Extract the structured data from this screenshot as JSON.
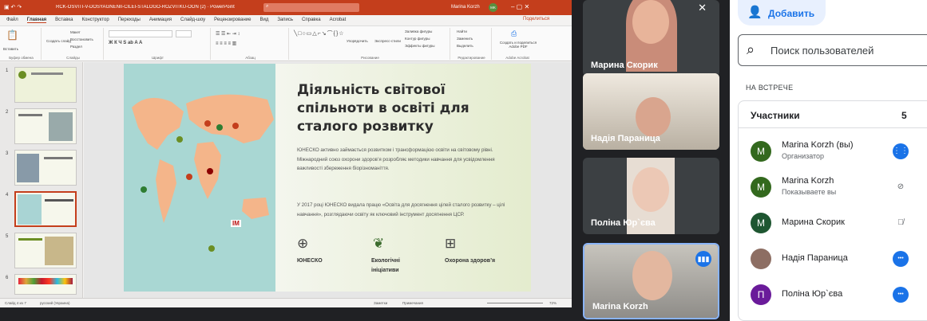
{
  "ppt": {
    "title": "RCK-OSVITI-V-DOSYAGNENII-CILEI-STALOGO-ROZVITKU-OON (2) · PowerPoint",
    "user": "Marina Korzh",
    "user_initials": "MK",
    "share": "Поделиться",
    "tabs": [
      "Файл",
      "Главная",
      "Вставка",
      "Конструктор",
      "Переходы",
      "Анимация",
      "Слайд-шоу",
      "Рецензирование",
      "Вид",
      "Запись",
      "Справка",
      "Acrobat"
    ],
    "ribbon": {
      "paste": "Вставить",
      "clipboard": "Буфер обмена",
      "create_slide": "Создать слайд",
      "layout": "Макет",
      "reset": "Восстановить",
      "section": "Раздел",
      "slides": "Слайды",
      "font": "Шрифт",
      "paragraph": "Абзац",
      "arrange": "Упорядочить",
      "quick_styles": "Экспресс-стили",
      "fill": "Заливка фигуры",
      "outline": "Контур фигуры",
      "effects": "Эффекты фигуры",
      "drawing": "Рисование",
      "find": "Найти",
      "replace": "Заменить",
      "select": "Выделить",
      "editing": "Редактирование",
      "create_pdf": "Создать и поделиться Adobe PDF",
      "acrobat": "Adobe Acrobat"
    },
    "thumb_numbers": [
      "1",
      "2",
      "3",
      "4",
      "5",
      "6"
    ],
    "status": {
      "slide": "Слайд 4 из 7",
      "lang": "русский (Украина)",
      "notes": "Заметки",
      "comments": "Примечания",
      "zoom": "72%"
    }
  },
  "slide": {
    "title": "Діяльність світової спільноти в освіті для сталого розвитку",
    "para1": "ЮНЕСКО активно займається розвитком і трансформацією освіти на світовому рівні. Міжнародний союз охорони здоров’я розробляє методики навчання для усвідомлення важливості збереження біорізноманіття.",
    "para2": "У 2017 році ЮНЕСКО видала працю «Освіта для досягнення цілей сталого розвитку – цілі навчання», розглядаючи освіту як ключовий інструмент досягнення ЦСР.",
    "features": [
      {
        "icon": "globe-icon",
        "label": "ЮНЕСКО"
      },
      {
        "icon": "leaf-icon",
        "label": "Екологічні ініціативи"
      },
      {
        "icon": "health-icon",
        "label": "Охорона здоров’я"
      }
    ],
    "map_badge": "IM"
  },
  "tiles": [
    {
      "name": "Марина Скорик",
      "muted": true
    },
    {
      "name": "Надія Параница",
      "muted": false
    },
    {
      "name": "Поліна Юр`єва",
      "muted": false
    },
    {
      "name": "Marina Korzh",
      "muted": false,
      "speaking": true
    }
  ],
  "panel": {
    "add_label": "Добавить",
    "search_placeholder": "Поиск пользователей",
    "section": "НА ВСТРЕЧЕ",
    "participants_label": "Участники",
    "participants_count": "5",
    "people": [
      {
        "name": "Marina Korzh (вы)",
        "sub": "Организатор",
        "initial": "M",
        "color": "#33691e",
        "action": "speaking"
      },
      {
        "name": "Marina Korzh",
        "sub": "Показываете вы",
        "initial": "M",
        "color": "#33691e",
        "action": "present-off"
      },
      {
        "name": "Марина Скорик",
        "sub": "",
        "initial": "M",
        "color": "#1e5631",
        "action": "mic-off"
      },
      {
        "name": "Надія Параница",
        "sub": "",
        "initial": "",
        "color": "#8d6e63",
        "action": "more"
      },
      {
        "name": "Поліна Юр`єва",
        "sub": "",
        "initial": "П",
        "color": "#6a1b9a",
        "action": "more"
      }
    ]
  }
}
